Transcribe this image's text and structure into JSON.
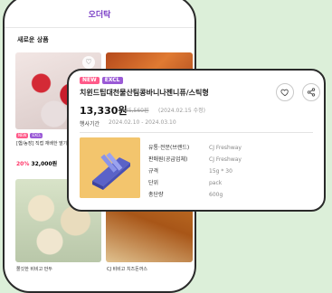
{
  "app": {
    "title": "오더탁",
    "section_title": "새로운 상품"
  },
  "product_cards": [
    {
      "badges": [
        "NEW",
        "EXCL"
      ],
      "name": "[햄/농장] 직접 재배한 딸기로 만드는 딸기",
      "discount": "20%",
      "price": "32,000원"
    }
  ],
  "bottom_names": [
    "쫄깃한 비비고 만두",
    "CJ 비비고 치즈돈까스"
  ],
  "popup": {
    "badges": [
      "NEW",
      "EXCL"
    ],
    "product_name": "치윈드팁대천물산팀콩바니나젠니퓨/스틱형",
    "price": "13,330원",
    "original_price": "35,560원",
    "price_period": "(2024.02.15 수정)",
    "sale_period_label": "행사기간",
    "sale_period": "2024.02.10 - 2024.03.10",
    "specs": [
      {
        "label": "유통·전문(브랜드)",
        "value": "CJ Freshway"
      },
      {
        "label": "판매원(공급업체)",
        "value": "CJ Freshway"
      },
      {
        "label": "규격",
        "value": "15g * 30"
      },
      {
        "label": "단위",
        "value": "pack"
      },
      {
        "label": "총단량",
        "value": "600g"
      }
    ]
  },
  "colors": {
    "background": "#dcefd9",
    "brand": "#7b3fc6",
    "new_badge": "#ff5b8a",
    "excl_badge": "#9a5ad6",
    "discount": "#ff3366"
  },
  "icons": [
    "heart-icon",
    "share-icon"
  ]
}
